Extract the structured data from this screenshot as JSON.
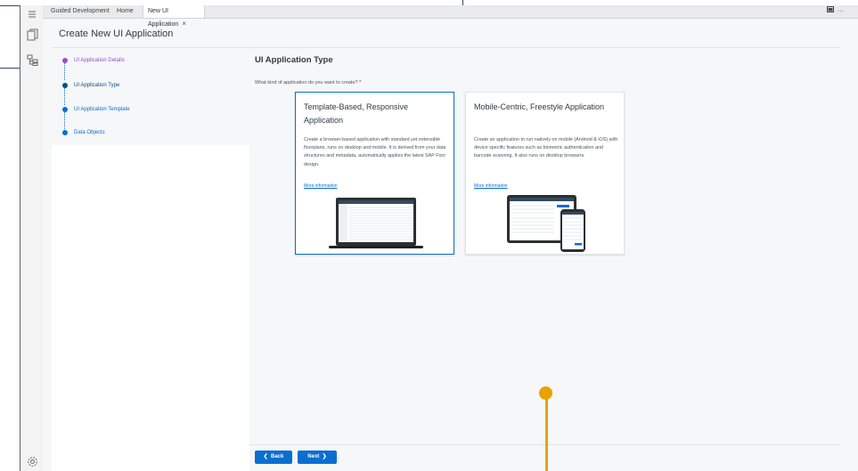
{
  "tabs": [
    {
      "label": "Guided Development"
    },
    {
      "label": "Home"
    },
    {
      "label": "New UI Application",
      "close": "×"
    }
  ],
  "page": {
    "title": "Create New UI Application"
  },
  "steps": [
    {
      "label": "UI Application Details",
      "color": "#8e52c9"
    },
    {
      "label": "UI Application Type",
      "color": "#0a4d8c"
    },
    {
      "label": "UI Application Template",
      "color": "#0a6ed1"
    },
    {
      "label": "Data Objects",
      "color": "#0a6ed1"
    }
  ],
  "content": {
    "section_title": "UI Application Type",
    "question": "What kind of application do you want to create?",
    "required_mark": "*"
  },
  "cards": [
    {
      "title": "Template-Based, Responsive Application",
      "description": "Create a browser-based application with standard yet extensible floorplans, runs on desktop and mobile. It is derived from your data structures and metadata, automatically applies the latest SAP Fiori design.",
      "link": "More information",
      "selected": true
    },
    {
      "title": "Mobile-Centric, Freestyle Application",
      "description": "Create an application to run natively on mobile (Android & iOS) with device specific features such as biometric authentication and barcode scanning. It also runs on desktop browsers.",
      "link": "More information",
      "selected": false
    }
  ],
  "footer": {
    "back_label": "Back",
    "next_label": "Next"
  },
  "icons": {
    "menu": "hamburger-icon",
    "explorer": "files-icon",
    "structure": "tree-icon",
    "settings": "gear-icon",
    "layout": "layout-icon",
    "more": "ellipsis-icon"
  },
  "colors": {
    "accent": "#0a6ed1",
    "marker": "#e8a200"
  }
}
